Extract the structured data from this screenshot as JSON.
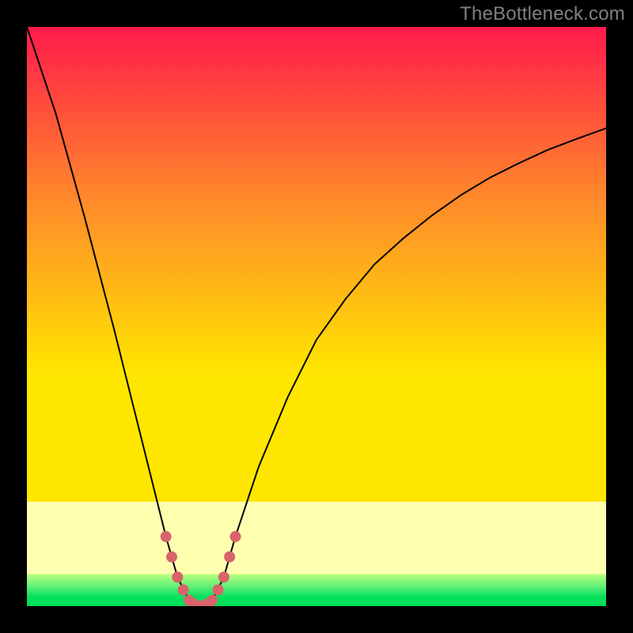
{
  "watermark": "TheBottleneck.com",
  "chart_data": {
    "type": "line",
    "title": "",
    "xlabel": "",
    "ylabel": "",
    "xlim": [
      0,
      100
    ],
    "ylim": [
      0,
      100
    ],
    "x_optimum": 30,
    "background_gradient": {
      "top": "#ff1a4c",
      "mid1": "#ff8a2a",
      "mid2": "#ffe600",
      "band_pale": "#ffffb0",
      "bottom": "#00e05a"
    },
    "series": [
      {
        "name": "bottleneck-curve",
        "x": [
          0,
          5,
          10,
          15,
          20,
          22,
          24,
          26,
          28,
          30,
          32,
          34,
          36,
          38,
          40,
          45,
          50,
          55,
          60,
          65,
          70,
          75,
          80,
          85,
          90,
          95,
          100
        ],
        "values": [
          100,
          85,
          67,
          48,
          28,
          20,
          12,
          5,
          1,
          0,
          1,
          5,
          12,
          18,
          24,
          36,
          46,
          53,
          59,
          63.5,
          67.5,
          71,
          74,
          76.5,
          78.8,
          80.7,
          82.5
        ],
        "color": "#000000",
        "stroke_width": 2
      },
      {
        "name": "optimum-marker",
        "x": [
          24,
          25,
          26,
          27,
          28,
          29,
          30,
          31,
          32,
          33,
          34,
          35,
          36
        ],
        "values": [
          12,
          8.5,
          5,
          2.8,
          1,
          0.3,
          0,
          0.3,
          1,
          2.8,
          5,
          8.5,
          12
        ],
        "color": "#d9636a",
        "stroke_width": 14,
        "linecap": "round",
        "dotted": true
      }
    ]
  }
}
